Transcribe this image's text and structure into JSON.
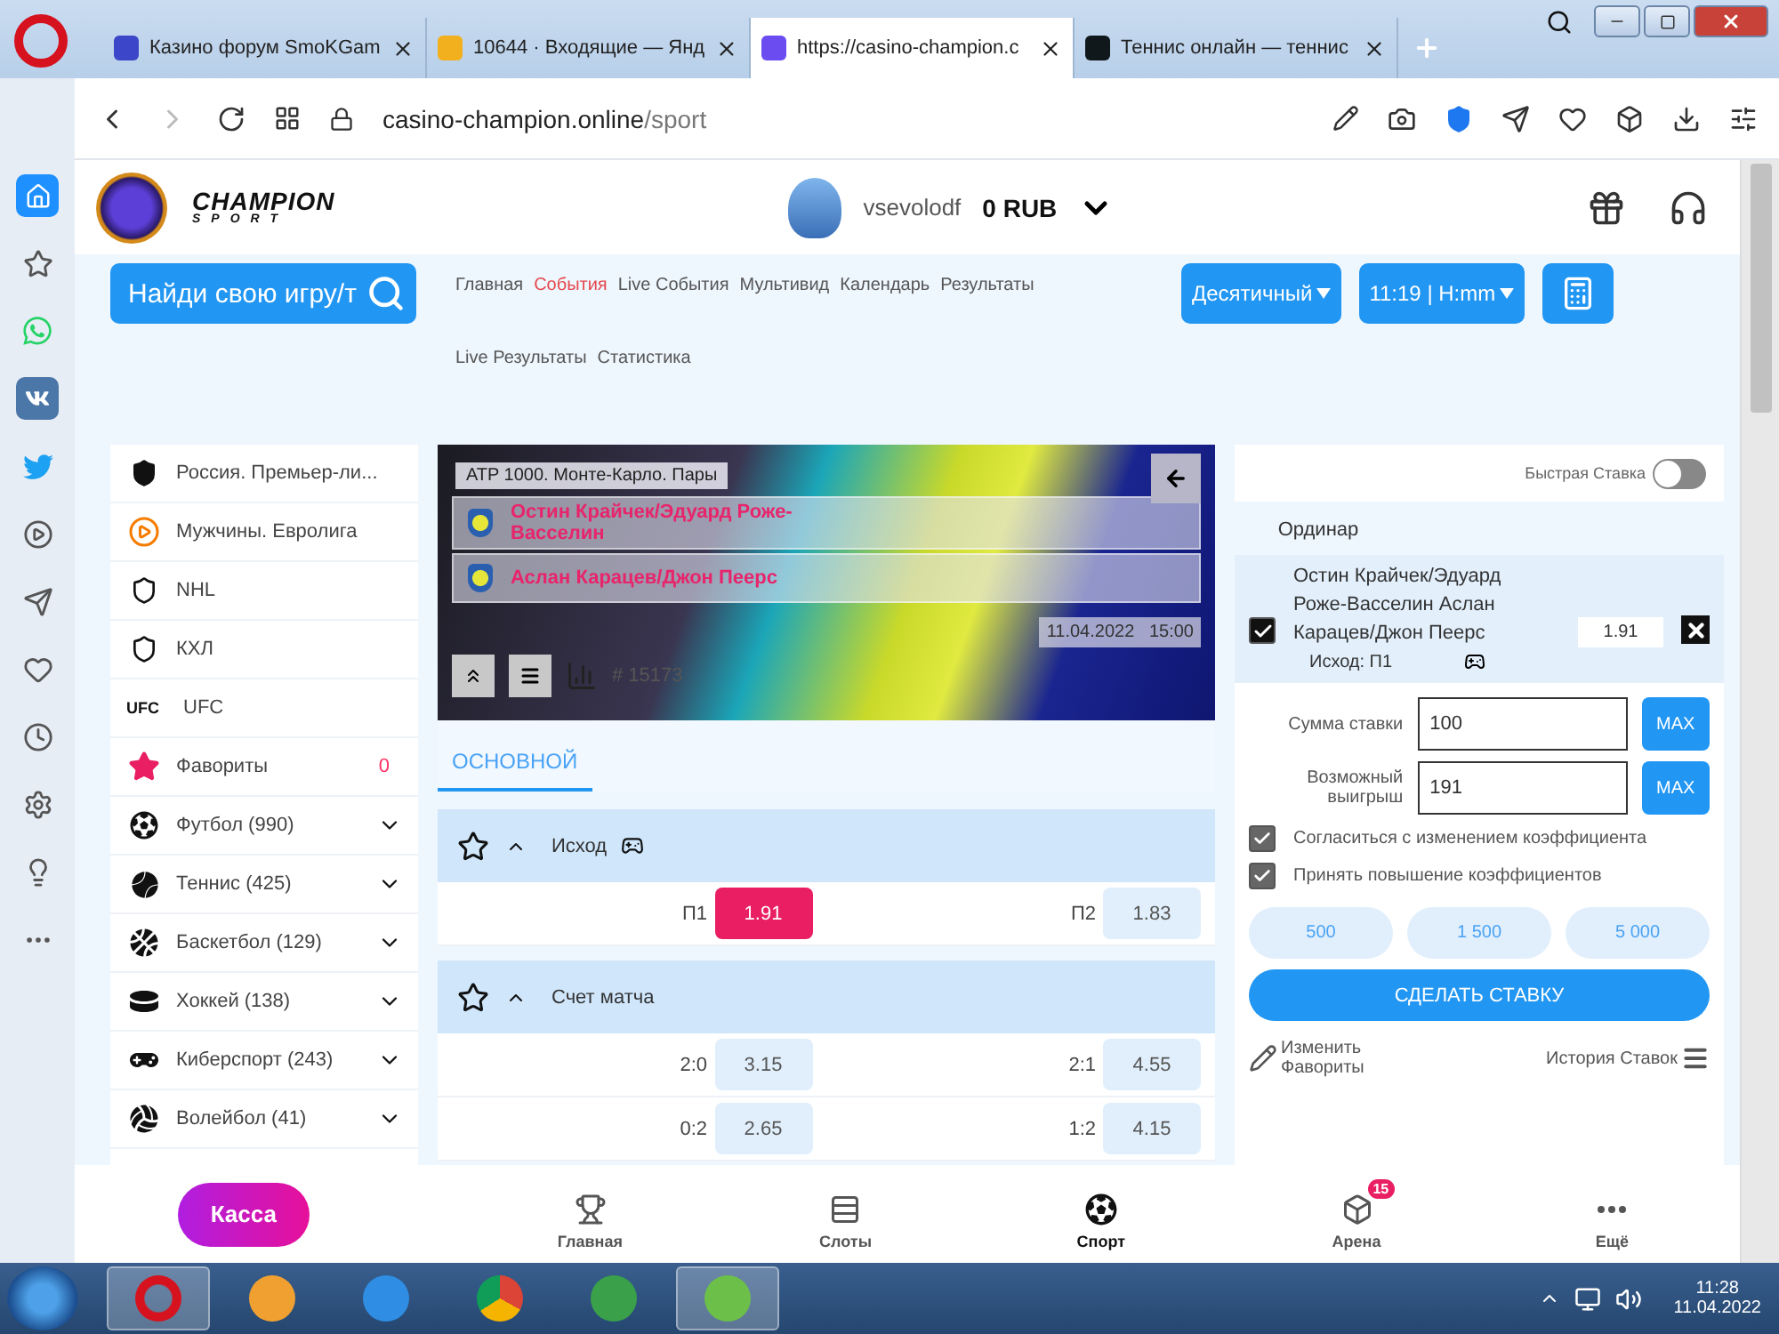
{
  "browser": {
    "tabs": [
      {
        "title": "Казино форум SmoKGam",
        "selected": false
      },
      {
        "title": "10644 · Входящие — Янд",
        "selected": false
      },
      {
        "title": "https://casino-champion.c",
        "selected": true
      },
      {
        "title": "Теннис онлайн — теннис",
        "selected": false
      }
    ],
    "url_host": "casino-champion.online",
    "url_path": "/sport"
  },
  "header": {
    "logo_title": "CHAMPION",
    "logo_subtitle": "SPORT",
    "username": "vsevolodf",
    "balance": "0 RUB"
  },
  "toolbar": {
    "search_label": "Найди свою игру/т",
    "nav": [
      {
        "label": "Главная",
        "selected": false
      },
      {
        "label": "События",
        "selected": true
      },
      {
        "label": "Live События",
        "selected": false
      },
      {
        "label": "Мультивид",
        "selected": false
      },
      {
        "label": "Календарь",
        "selected": false
      },
      {
        "label": "Результаты",
        "selected": false
      },
      {
        "label": "Live Результаты",
        "selected": false
      },
      {
        "label": "Статистика",
        "selected": false
      }
    ],
    "odds_format": "Десятичный",
    "time_format": "11:19 | H:mm"
  },
  "sidebar": [
    {
      "kind": "league",
      "label": "Россия. Премьер-ли..."
    },
    {
      "kind": "league",
      "label": "Мужчины. Евролига"
    },
    {
      "kind": "league",
      "label": "NHL"
    },
    {
      "kind": "league",
      "label": "КХЛ"
    },
    {
      "kind": "league",
      "label": "UFC",
      "logo_text": "UFC"
    },
    {
      "kind": "favorites",
      "label": "Фавориты",
      "count": "0"
    },
    {
      "kind": "sport",
      "label": "Футбол (990)",
      "expanded": false
    },
    {
      "kind": "sport",
      "label": "Теннис (425)",
      "expanded": false
    },
    {
      "kind": "sport",
      "label": "Баскетбол (129)",
      "expanded": false
    },
    {
      "kind": "sport",
      "label": "Хоккей (138)",
      "expanded": false
    },
    {
      "kind": "sport",
      "label": "Киберспорт (243)",
      "expanded": false
    },
    {
      "kind": "sport",
      "label": "Волейбол (41)",
      "expanded": false
    }
  ],
  "event": {
    "tournament": "ATP 1000. Монте-Карло. Пары",
    "teams": [
      "Остин Крайчек/Эдуард Роже-Васселин",
      "Аслан Карацев/Джон Пеерс"
    ],
    "date": "11.04.2022",
    "time": "15:00",
    "event_id": "# 15173"
  },
  "market_tabs": [
    {
      "label": "ОСНОВНОЙ",
      "selected": true
    }
  ],
  "markets": [
    {
      "title": "Исход",
      "expanded": true,
      "outcomes": [
        {
          "label": "П1",
          "odds": "1.91",
          "selected": true
        },
        {
          "label": "П2",
          "odds": "1.83",
          "selected": false
        }
      ]
    },
    {
      "title": "Счет матча",
      "expanded": true,
      "outcomes": [
        {
          "label": "2:0",
          "odds": "3.15",
          "selected": false
        },
        {
          "label": "2:1",
          "odds": "4.55",
          "selected": false
        },
        {
          "label": "0:2",
          "odds": "2.65",
          "selected": false
        },
        {
          "label": "1:2",
          "odds": "4.15",
          "selected": false
        }
      ]
    }
  ],
  "betslip": {
    "quick_bet_label": "Быстрая Ставка",
    "quick_bet_on": false,
    "tabs": [
      {
        "label": "Ординар",
        "selected": true
      }
    ],
    "bet": {
      "checked": true,
      "teams": [
        "Остин Крайчек/Эдуард Роже-Васселин",
        "Аслан Карацев/Джон Пеерс"
      ],
      "odds": "1.91",
      "outcome": "Исход: П1"
    },
    "fields": [
      {
        "label": "Сумма ставки",
        "value": "100",
        "button": "MAX"
      },
      {
        "label": "Возможный выигрыш",
        "value": "191",
        "button": "MAX"
      }
    ],
    "options": [
      {
        "label": "Согласиться с изменением коэффициента",
        "checked": true
      },
      {
        "label": "Принять повышение коэффициентов",
        "checked": true
      }
    ],
    "quick_amounts": [
      "500",
      "1 500",
      "5 000"
    ],
    "submit": "СДЕЛАТЬ СТАВКУ",
    "edit_favorites": "Изменить Фавориты",
    "history": "История Ставок"
  },
  "bottom_nav": {
    "cashier": "Касса",
    "items": [
      {
        "label": "Главная",
        "selected": false
      },
      {
        "label": "Слоты",
        "selected": false
      },
      {
        "label": "Спорт",
        "selected": true
      },
      {
        "label": "Арена",
        "selected": false,
        "badge": "15"
      },
      {
        "label": "Ещё",
        "selected": false
      }
    ]
  },
  "taskbar": {
    "time": "11:28",
    "date": "11.04.2022"
  }
}
